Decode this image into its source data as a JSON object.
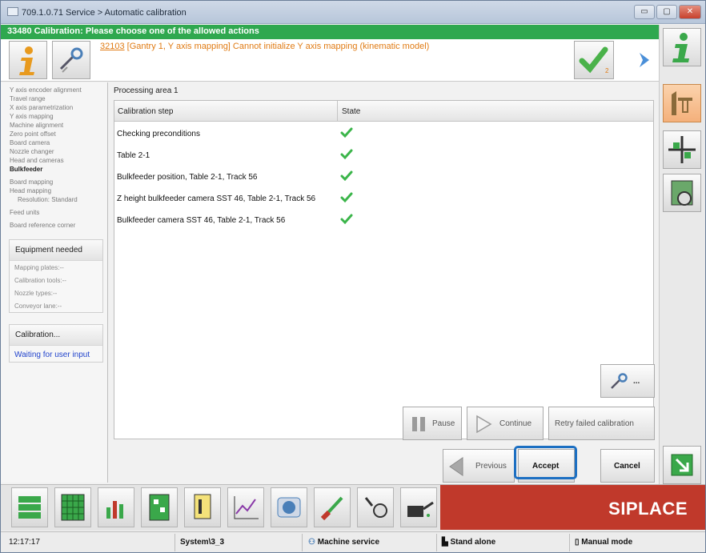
{
  "window": {
    "title": "709.1.0.71 Service > Automatic calibration",
    "min_label": "▭",
    "max_label": "▢",
    "close_label": "✕"
  },
  "banner": "33480 Calibration: Please choose one of the allowed actions",
  "message": {
    "code": "32103",
    "text": " [Gantry 1, Y axis mapping] Cannot initialize Y axis mapping (kinematic model)",
    "badge": "2"
  },
  "left": {
    "steps": [
      {
        "label": "Y axis encoder alignment",
        "cls": ""
      },
      {
        "label": "Travel range",
        "cls": ""
      },
      {
        "label": "X axis parametrization",
        "cls": ""
      },
      {
        "label": "Y axis mapping",
        "cls": ""
      },
      {
        "label": "Machine alignment",
        "cls": ""
      },
      {
        "label": "Zero point offset",
        "cls": ""
      },
      {
        "label": "Board camera",
        "cls": ""
      },
      {
        "label": "Nozzle changer",
        "cls": ""
      },
      {
        "label": "Head and cameras",
        "cls": ""
      },
      {
        "label": "Bulkfeeder",
        "cls": "b"
      },
      {
        "label": "Board mapping",
        "cls": "gap"
      },
      {
        "label": "Head mapping",
        "cls": ""
      },
      {
        "label": "Resolution: Standard",
        "cls": "ind"
      },
      {
        "label": "Feed units",
        "cls": "gap"
      },
      {
        "label": "Board reference corner",
        "cls": "gap"
      }
    ],
    "equipment": {
      "title": "Equipment needed",
      "items": [
        "Mapping plates:--",
        "Calibration tools:--",
        "Nozzle types:--",
        "Conveyor lane:--"
      ]
    },
    "calibration": {
      "title": "Calibration...",
      "status": "Waiting for user input"
    }
  },
  "main": {
    "area_label": "Processing area 1",
    "columns": [
      "Calibration step",
      "State"
    ],
    "rows": [
      {
        "step": "Checking preconditions",
        "state": "ok"
      },
      {
        "step": "Table 2-1",
        "state": "ok"
      },
      {
        "step": "Bulkfeeder position, Table 2-1, Track 56",
        "state": "ok"
      },
      {
        "step": "Z height bulkfeeder camera SST 46, Table 2-1, Track 56",
        "state": "ok"
      },
      {
        "step": "Bulkfeeder camera SST 46, Table 2-1, Track 56",
        "state": "ok"
      }
    ],
    "tools_label": "...",
    "buttons": {
      "pause": "Pause",
      "continue": "Continue",
      "retry": "Retry failed calibration",
      "previous": "Previous",
      "accept": "Accept",
      "cancel": "Cancel"
    }
  },
  "brand": "SIPLACE",
  "status": {
    "time": "12:17:17",
    "station": "System\\3_3",
    "service": "Machine service",
    "mode1": "Stand alone",
    "mode2": "Manual mode"
  },
  "colors": {
    "banner": "#2fa84f",
    "warning_text": "#e07b14",
    "brand_red": "#c0392b",
    "highlight": "#1c6fc2",
    "active_orange": "#f4b07b",
    "check_green": "#3bb54a"
  }
}
